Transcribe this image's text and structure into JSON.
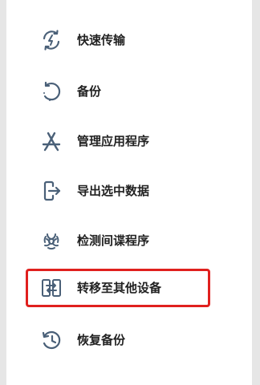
{
  "menu": {
    "accent_color": "#e0201e",
    "icon_color": "#4a6078",
    "items": [
      {
        "label": "快速传输",
        "icon": "fast-transfer-icon"
      },
      {
        "label": "备份",
        "icon": "backup-icon"
      },
      {
        "label": "管理应用程序",
        "icon": "app-store-icon"
      },
      {
        "label": "导出选中数据",
        "icon": "export-icon"
      },
      {
        "label": "检测间谍程序",
        "icon": "biohazard-icon"
      },
      {
        "label": "转移至其他设备",
        "icon": "transfer-device-icon",
        "highlighted": true
      },
      {
        "label": "恢复备份",
        "icon": "restore-icon"
      }
    ]
  }
}
